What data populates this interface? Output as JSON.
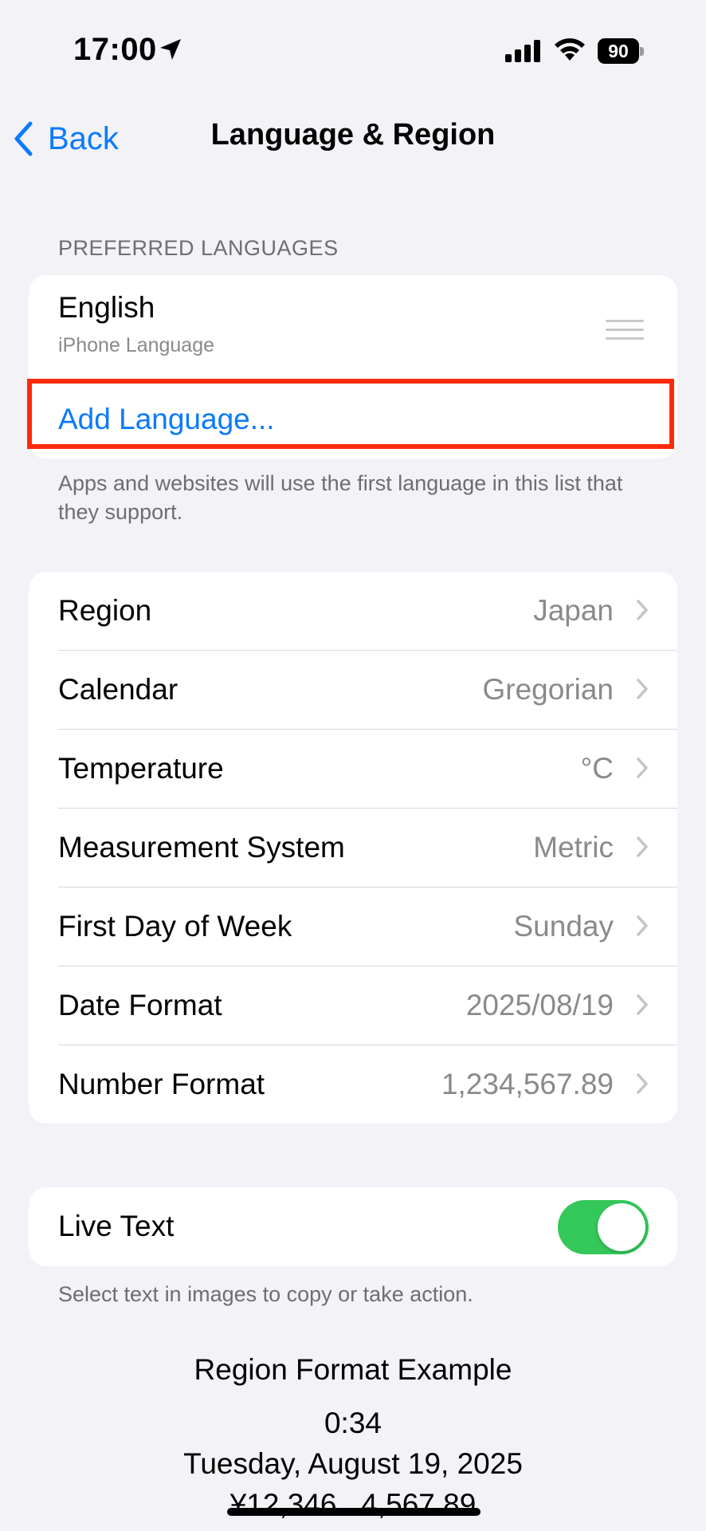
{
  "status_bar": {
    "time": "17:00",
    "battery": "90"
  },
  "nav": {
    "back_label": "Back",
    "title": "Language & Region"
  },
  "preferred_languages": {
    "header": "PREFERRED LANGUAGES",
    "languages": [
      {
        "name": "English",
        "subtitle": "iPhone Language"
      }
    ],
    "add_label": "Add Language...",
    "footer": "Apps and websites will use the first language in this list that they support."
  },
  "settings": [
    {
      "label": "Region",
      "value": "Japan"
    },
    {
      "label": "Calendar",
      "value": "Gregorian"
    },
    {
      "label": "Temperature",
      "value": "°C"
    },
    {
      "label": "Measurement System",
      "value": "Metric"
    },
    {
      "label": "First Day of Week",
      "value": "Sunday"
    },
    {
      "label": "Date Format",
      "value": "2025/08/19"
    },
    {
      "label": "Number Format",
      "value": "1,234,567.89"
    }
  ],
  "live_text": {
    "label": "Live Text",
    "enabled": true,
    "footer": "Select text in images to copy or take action."
  },
  "region_example": {
    "title": "Region Format Example",
    "time": "0:34",
    "date": "Tuesday, August 19, 2025",
    "numbers": "¥12,346   4,567.89"
  },
  "colors": {
    "accent": "#0a7aff",
    "toggle_on": "#34c759",
    "highlight": "#ff2a0a",
    "background": "#f2f2f7"
  },
  "icons": [
    "location-arrow-icon",
    "cellular-signal-icon",
    "wifi-icon",
    "battery-icon",
    "chevron-left-icon",
    "drag-handle-icon",
    "chevron-right-icon"
  ]
}
